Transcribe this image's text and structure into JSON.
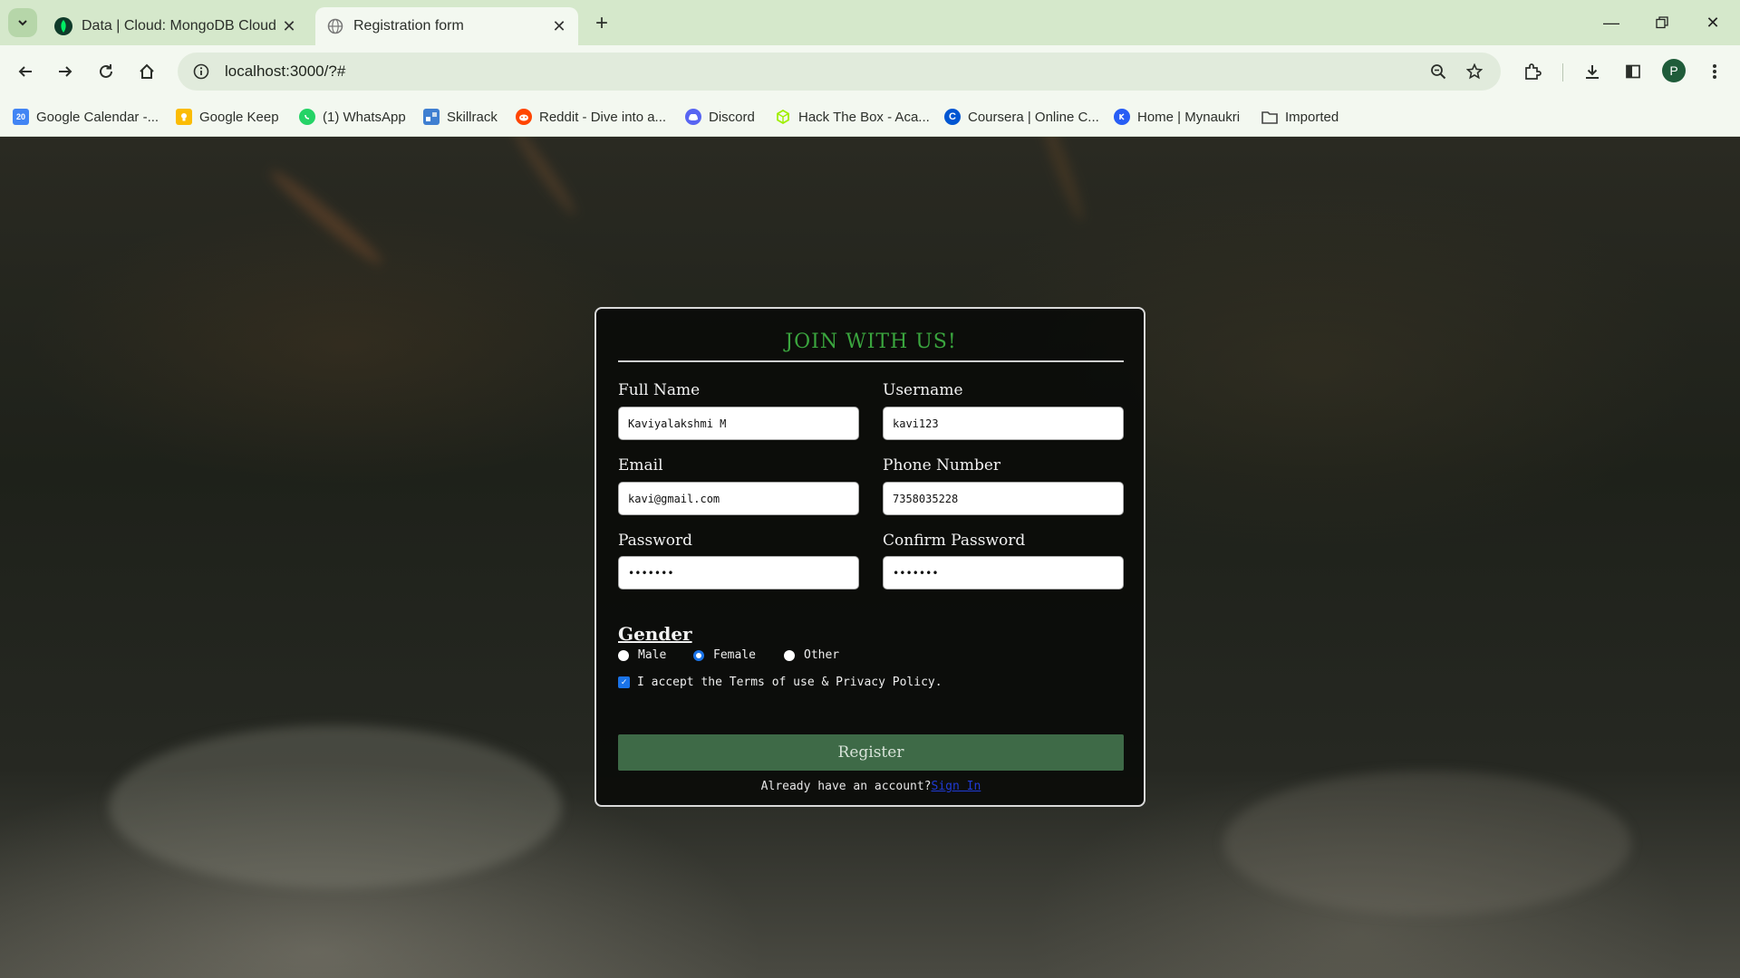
{
  "browser": {
    "tabs": [
      {
        "title": "Data | Cloud: MongoDB Cloud",
        "active": false
      },
      {
        "title": "Registration form",
        "active": true
      }
    ],
    "address": "localhost:3000/?#",
    "avatar_letter": "P",
    "bookmarks": [
      {
        "label": "Google Calendar -...",
        "icon": "calendar-icon",
        "color": "#4285f4",
        "glyph": "20"
      },
      {
        "label": "Google Keep",
        "icon": "keep-icon",
        "color": "#fbbc04",
        "glyph": ""
      },
      {
        "label": "(1) WhatsApp",
        "icon": "whatsapp-icon",
        "color": "#25d366",
        "glyph": ""
      },
      {
        "label": "Skillrack",
        "icon": "skillrack-icon",
        "color": "#3f7fd1",
        "glyph": ""
      },
      {
        "label": "Reddit - Dive into a...",
        "icon": "reddit-icon",
        "color": "#ff4500",
        "glyph": ""
      },
      {
        "label": "Discord",
        "icon": "discord-icon",
        "color": "#5865f2",
        "glyph": ""
      },
      {
        "label": "Hack The Box - Aca...",
        "icon": "hackthebox-icon",
        "color": "#9fef00",
        "glyph": ""
      },
      {
        "label": "Coursera | Online C...",
        "icon": "coursera-icon",
        "color": "#0056d2",
        "glyph": "C"
      },
      {
        "label": "Home | Mynaukri",
        "icon": "naukri-icon",
        "color": "#275df5",
        "glyph": ""
      },
      {
        "label": "Imported",
        "icon": "folder-icon",
        "color": "#444444",
        "glyph": ""
      }
    ]
  },
  "form": {
    "title": "JOIN WITH US!",
    "fields": {
      "full_name": {
        "label": "Full Name",
        "value": "Kaviyalakshmi M"
      },
      "username": {
        "label": "Username",
        "value": "kavi123"
      },
      "email": {
        "label": "Email",
        "value": "kavi@gmail.com"
      },
      "phone": {
        "label": "Phone Number",
        "value": "7358035228"
      },
      "password": {
        "label": "Password",
        "value": "•••••••"
      },
      "confirm_password": {
        "label": "Confirm Password",
        "value": "•••••••"
      }
    },
    "gender": {
      "label": "Gender",
      "options": [
        "Male",
        "Female",
        "Other"
      ],
      "selected": "Female"
    },
    "terms": {
      "label": "I accept the Terms of use & Privacy Policy.",
      "checked": true
    },
    "register_label": "Register",
    "already_text": "Already have an account?",
    "signin_link": "Sign In"
  },
  "colors": {
    "title_green": "#3aa53e",
    "register_bg": "#3e6a47",
    "accent_blue": "#1a73e8",
    "chrome_tab_bg": "#d5e8cb"
  }
}
